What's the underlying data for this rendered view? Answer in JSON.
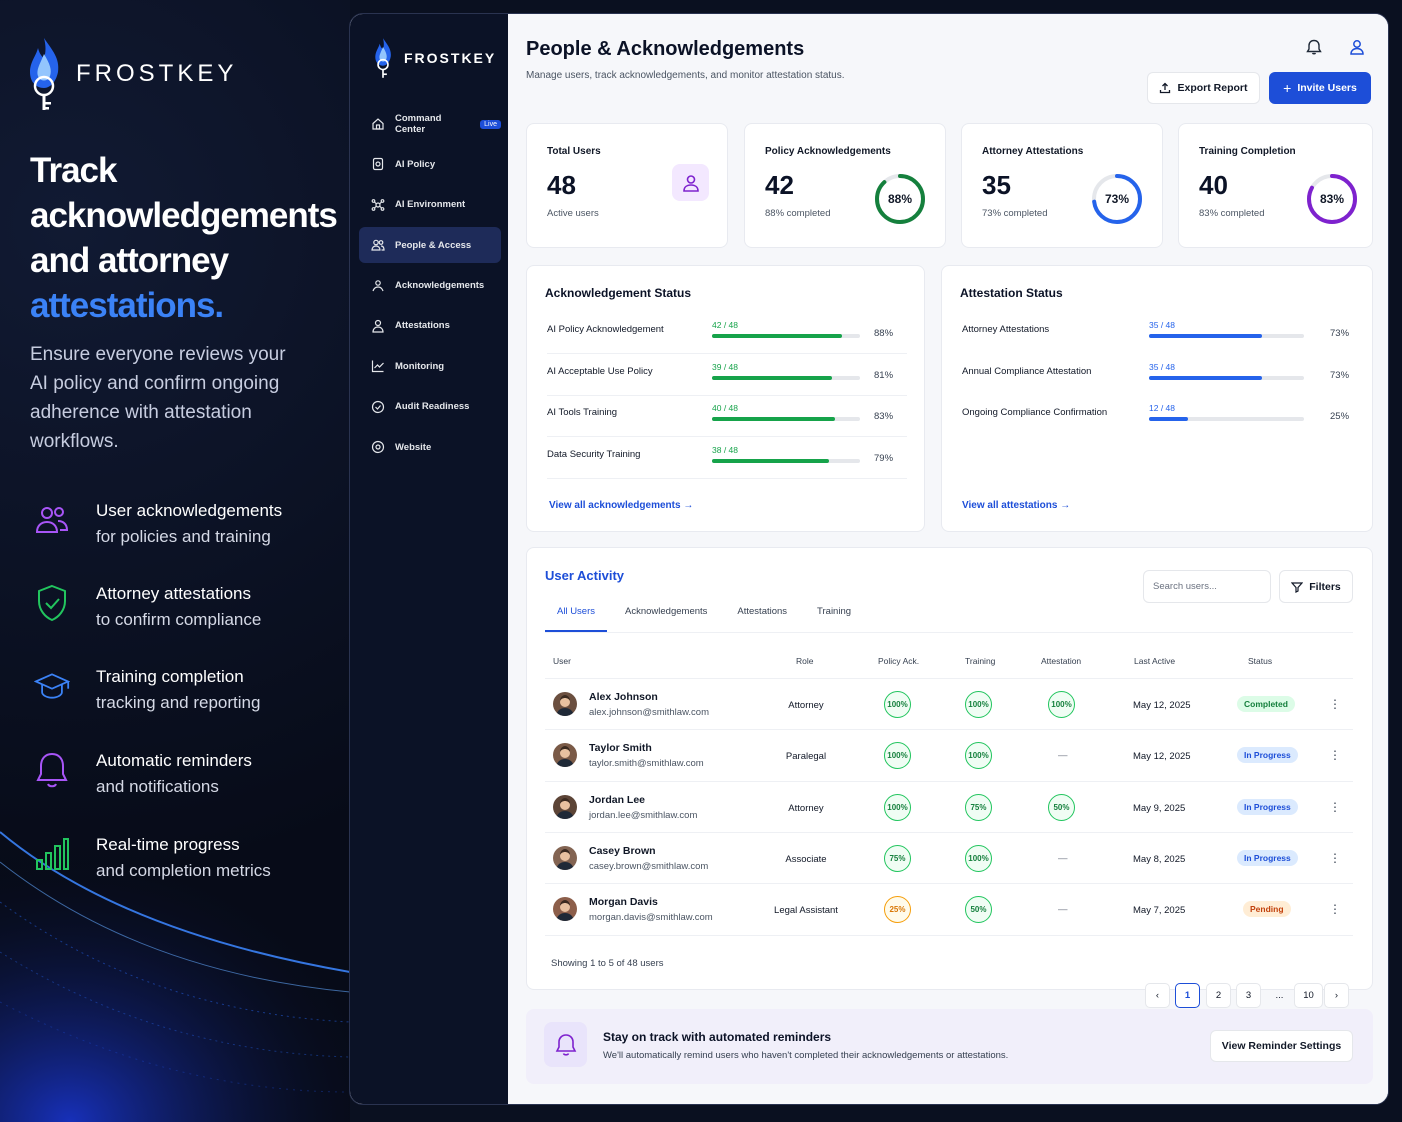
{
  "promo": {
    "brand": "FROSTKEY",
    "hero_line1": "Track",
    "hero_line2": "acknowledgements",
    "hero_line3": "and attorney",
    "hero_accent": "attestations.",
    "subtitle": "Ensure everyone reviews your AI policy and confirm ongoing adherence with attestation workflows.",
    "features": [
      {
        "icon": "users-icon",
        "title": "User acknowledgements",
        "desc": "for policies and training"
      },
      {
        "icon": "shield-check-icon",
        "title": "Attorney attestations",
        "desc": "to confirm compliance"
      },
      {
        "icon": "graduation-cap-icon",
        "title": "Training completion",
        "desc": "tracking and reporting"
      },
      {
        "icon": "bell-icon",
        "title": "Automatic reminders",
        "desc": "and notifications"
      },
      {
        "icon": "bar-chart-icon",
        "title": "Real-time progress",
        "desc": "and completion metrics"
      }
    ]
  },
  "sidebar": {
    "brand": "FROSTKEY",
    "live_badge": "Live",
    "items": [
      {
        "label": "Command Center",
        "icon": "home-icon"
      },
      {
        "label": "AI Policy",
        "icon": "document-icon"
      },
      {
        "label": "AI Environment",
        "icon": "network-icon"
      },
      {
        "label": "People & Access",
        "icon": "people-icon"
      },
      {
        "label": "Acknowledgements",
        "icon": "hand-icon"
      },
      {
        "label": "Attestations",
        "icon": "person-badge-icon"
      },
      {
        "label": "Monitoring",
        "icon": "chart-line-icon"
      },
      {
        "label": "Audit Readiness",
        "icon": "check-circle-icon"
      },
      {
        "label": "Website",
        "icon": "globe-icon"
      }
    ],
    "active_index": 3
  },
  "header": {
    "title": "People & Acknowledgements",
    "subtitle": "Manage users, track acknowledgements, and monitor attestation status.",
    "export_label": "Export Report",
    "invite_label": "Invite Users"
  },
  "stats": [
    {
      "label": "Total Users",
      "value": "48",
      "caption": "Active users"
    },
    {
      "label": "Policy Acknowledgements",
      "value": "42",
      "caption": "88% completed",
      "percent": 88,
      "ring_text": "88%",
      "color": "#15803d"
    },
    {
      "label": "Attorney Attestations",
      "value": "35",
      "caption": "73% completed",
      "percent": 73,
      "ring_text": "73%",
      "color": "#2563eb"
    },
    {
      "label": "Training Completion",
      "value": "40",
      "caption": "83% completed",
      "percent": 83,
      "ring_text": "83%",
      "color": "#7e22ce"
    }
  ],
  "ack_status": {
    "title": "Acknowledgement Status",
    "rows": [
      {
        "name": "AI Policy Acknowledgement",
        "fraction": "42 / 48",
        "percent": 88,
        "pct_label": "88%"
      },
      {
        "name": "AI Acceptable Use Policy",
        "fraction": "39 / 48",
        "percent": 81,
        "pct_label": "81%"
      },
      {
        "name": "AI Tools Training",
        "fraction": "40 / 48",
        "percent": 83,
        "pct_label": "83%"
      },
      {
        "name": "Data Security Training",
        "fraction": "38 / 48",
        "percent": 79,
        "pct_label": "79%"
      }
    ],
    "link": "View all acknowledgements",
    "color": "#16a34a"
  },
  "att_status": {
    "title": "Attestation Status",
    "rows": [
      {
        "name": "Attorney Attestations",
        "fraction": "35 / 48",
        "percent": 73,
        "pct_label": "73%"
      },
      {
        "name": "Annual Compliance Attestation",
        "fraction": "35 / 48",
        "percent": 73,
        "pct_label": "73%"
      },
      {
        "name": "Ongoing Compliance Confirmation",
        "fraction": "12 / 48",
        "percent": 25,
        "pct_label": "25%"
      }
    ],
    "link": "View all attestations",
    "color": "#2563eb"
  },
  "activity": {
    "title": "User Activity",
    "search_placeholder": "Search users...",
    "filters_label": "Filters",
    "tabs": [
      "All Users",
      "Acknowledgements",
      "Attestations",
      "Training"
    ],
    "columns": [
      "User",
      "Role",
      "Policy Ack.",
      "Training",
      "Attestation",
      "Last Active",
      "Status"
    ],
    "rows": [
      {
        "name": "Alex Johnson",
        "email": "alex.johnson@smithlaw.com",
        "role": "Attorney",
        "policy": "100%",
        "training": "100%",
        "attestation": "100%",
        "last_active": "May 12, 2025",
        "status": "Completed"
      },
      {
        "name": "Taylor Smith",
        "email": "taylor.smith@smithlaw.com",
        "role": "Paralegal",
        "policy": "100%",
        "training": "100%",
        "attestation": "—",
        "last_active": "May 12, 2025",
        "status": "In Progress"
      },
      {
        "name": "Jordan Lee",
        "email": "jordan.lee@smithlaw.com",
        "role": "Attorney",
        "policy": "100%",
        "training": "75%",
        "attestation": "50%",
        "last_active": "May 9, 2025",
        "status": "In Progress"
      },
      {
        "name": "Casey Brown",
        "email": "casey.brown@smithlaw.com",
        "role": "Associate",
        "policy": "75%",
        "training": "100%",
        "attestation": "—",
        "last_active": "May 8, 2025",
        "status": "In Progress"
      },
      {
        "name": "Morgan Davis",
        "email": "morgan.davis@smithlaw.com",
        "role": "Legal Assistant",
        "policy": "25%",
        "training": "50%",
        "attestation": "—",
        "last_active": "May 7, 2025",
        "status": "Pending"
      }
    ],
    "showing": "Showing 1 to 5 of 48 users",
    "pages": [
      "‹",
      "1",
      "2",
      "3",
      "...",
      "10",
      "›"
    ],
    "current_page": "1"
  },
  "reminder": {
    "title": "Stay on track with automated reminders",
    "desc": "We'll automatically remind users who haven't completed their acknowledgements or attestations.",
    "button": "View Reminder Settings"
  }
}
